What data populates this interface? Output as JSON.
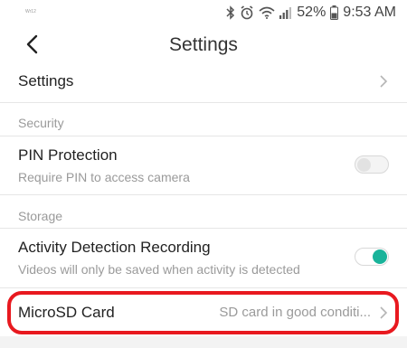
{
  "status_bar": {
    "left_text": "Wr12",
    "battery": "52%",
    "time": "9:53 AM",
    "icons": [
      "bluetooth-icon",
      "alarm-icon",
      "wifi-icon",
      "signal-icon",
      "battery-icon"
    ]
  },
  "header": {
    "title": "Settings",
    "back_icon": "chevron-left-icon"
  },
  "rows": {
    "settings": {
      "title": "Settings"
    },
    "security_section": "Security",
    "pin": {
      "title": "PIN Protection",
      "subtitle": "Require PIN to access camera",
      "enabled": false
    },
    "storage_section": "Storage",
    "activity": {
      "title": "Activity Detection Recording",
      "subtitle": "Videos will only be saved when activity is detected",
      "enabled": true
    },
    "microsd": {
      "title": "MicroSD Card",
      "value": "SD card in good conditi..."
    }
  },
  "colors": {
    "toggle_on": "#19b39a",
    "highlight": "#e8191f",
    "secondary_text": "#9a9a9a"
  }
}
